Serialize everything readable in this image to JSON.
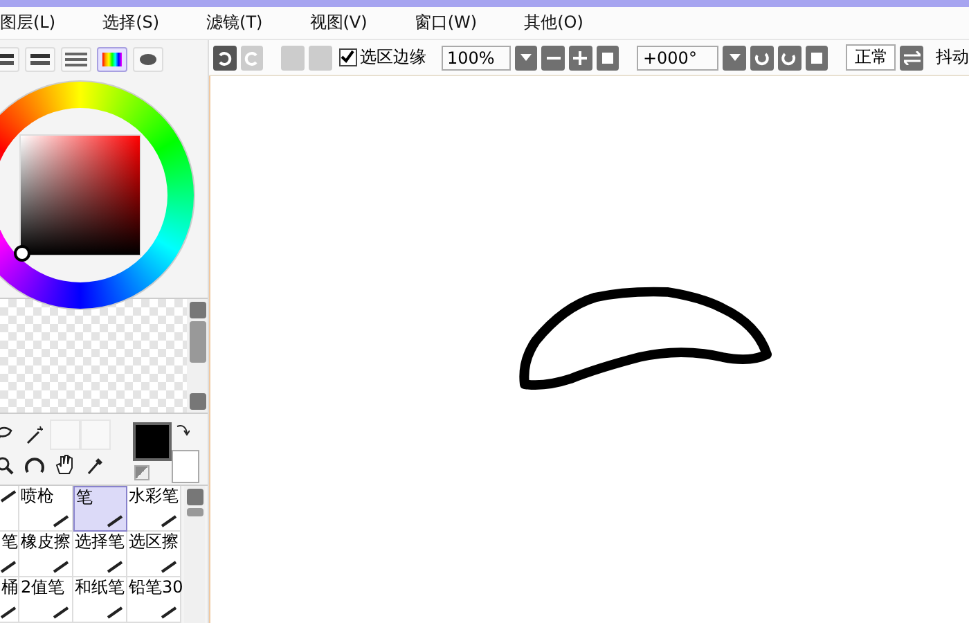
{
  "menu": [
    {
      "label": "图层(L)"
    },
    {
      "label": "选择(S)"
    },
    {
      "label": "滤镜(T)"
    },
    {
      "label": "视图(V)"
    },
    {
      "label": "窗口(W)"
    },
    {
      "label": "其他(O)"
    }
  ],
  "color_modes": [
    {
      "kind": "bars",
      "selected": false
    },
    {
      "kind": "bars",
      "selected": false
    },
    {
      "kind": "lines",
      "selected": false
    },
    {
      "kind": "palette",
      "selected": true
    },
    {
      "kind": "blob",
      "selected": false
    }
  ],
  "toolbar": {
    "selection_edge": {
      "label": "选区边缘",
      "checked": true
    },
    "zoom": "100%",
    "rotation": "+000°",
    "mode_button": "正常",
    "stabilizer": "抖动"
  },
  "brushes": [
    {
      "selected": false
    },
    {
      "label": "喷枪",
      "selected": false
    },
    {
      "label": "笔",
      "selected": true
    },
    {
      "label": "水彩笔",
      "selected": false
    },
    {
      "label": "笔",
      "selected": false
    },
    {
      "label": "橡皮擦",
      "selected": false
    },
    {
      "label": "选择笔",
      "selected": false
    },
    {
      "label": "选区擦",
      "selected": false
    },
    {
      "label": "桶",
      "selected": false
    },
    {
      "label": "2值笔",
      "selected": false
    },
    {
      "label": "和纸笔",
      "selected": false
    },
    {
      "label": "铅笔30",
      "selected": false
    }
  ]
}
